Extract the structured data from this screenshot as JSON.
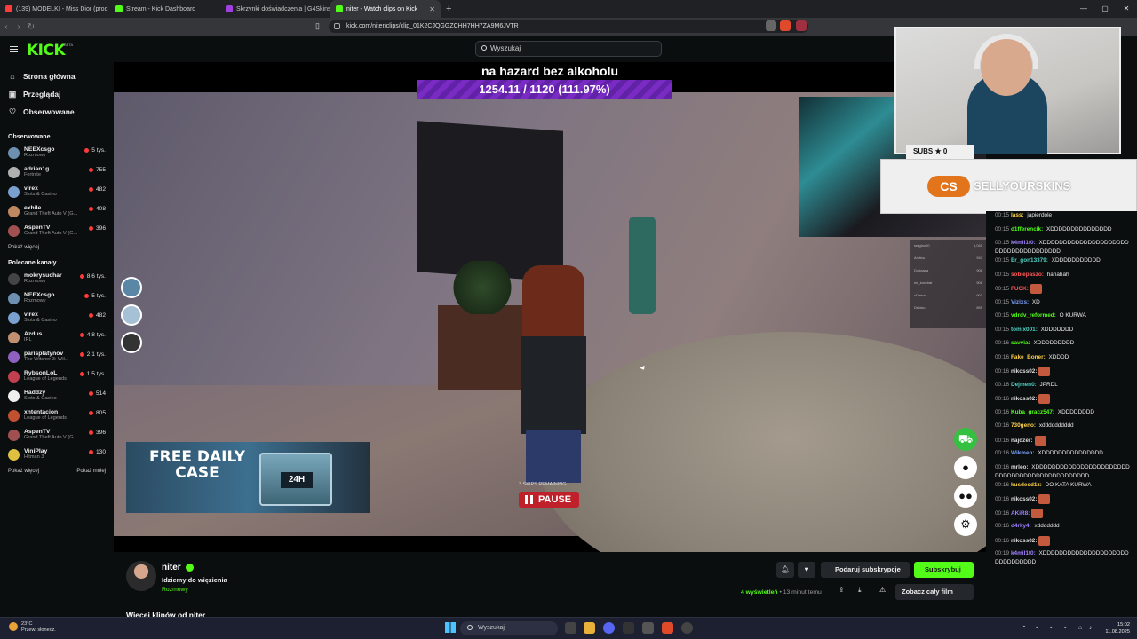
{
  "browser": {
    "tabs": [
      {
        "label": "(139) MODELKI - Miss Dior (prod",
        "color": "#ff3b3b"
      },
      {
        "label": "Stream - Kick Dashboard",
        "color": "#53fc18"
      },
      {
        "label": "Skrzynki doświadczenia | G4Skins - O",
        "color": "#a040e0"
      },
      {
        "label": "niter - Watch clips on Kick",
        "color": "#53fc18"
      }
    ],
    "new_tab": "+",
    "url": "kick.com/niter/clips/clip_01K2CJQGGZCHH7HH7ZA9M6JVTR"
  },
  "header": {
    "logo": "KICK",
    "logo_tag": "BETA",
    "search_placeholder": "Wyszukaj"
  },
  "sidebar": {
    "nav": [
      {
        "label": "Strona główna",
        "icon": "home-icon",
        "glyph": "⌂"
      },
      {
        "label": "Przeglądaj",
        "icon": "browse-icon",
        "glyph": "▣"
      },
      {
        "label": "Obserwowane",
        "icon": "heart-icon",
        "glyph": "♡"
      }
    ],
    "followed_title": "Obserwowane",
    "followed": [
      {
        "name": "NEEXcsgo",
        "category": "Rozmowy",
        "viewers": "5 tys.",
        "color": "#6d8fb0"
      },
      {
        "name": "adrian1g",
        "category": "Fortnite",
        "viewers": "755",
        "color": "#b0b0b0"
      },
      {
        "name": "virex",
        "category": "Slots & Casino",
        "viewers": "482",
        "color": "#7aa0d0"
      },
      {
        "name": "exhile",
        "category": "Grand Theft Auto V (G...",
        "viewers": "408",
        "color": "#c08860"
      },
      {
        "name": "AspenTV",
        "category": "Grand Theft Auto V (G...",
        "viewers": "396",
        "color": "#a05050"
      }
    ],
    "show_more": "Pokaż więcej",
    "recommended_title": "Polecane kanały",
    "recommended": [
      {
        "name": "mokrysuchar",
        "category": "Rozmowy",
        "viewers": "8,6 tys.",
        "color": "#444"
      },
      {
        "name": "NEEXcsgo",
        "category": "Rozmowy",
        "viewers": "5 tys.",
        "color": "#6d8fb0"
      },
      {
        "name": "virex",
        "category": "Slots & Casino",
        "viewers": "482",
        "color": "#7aa0d0"
      },
      {
        "name": "Azdus",
        "category": "IRL",
        "viewers": "4,8 tys.",
        "color": "#c09070"
      },
      {
        "name": "parisplatynov",
        "category": "The Witcher 3: Wil...",
        "viewers": "2,1 tys.",
        "color": "#9060c0"
      },
      {
        "name": "RybsonLoL",
        "category": "League of Legends",
        "viewers": "1,5 tys.",
        "color": "#c04050"
      },
      {
        "name": "Haddzy",
        "category": "Slots & Casino",
        "viewers": "514",
        "color": "#eee"
      },
      {
        "name": "xntentacion",
        "category": "League of Legends",
        "viewers": "805",
        "color": "#c05030"
      },
      {
        "name": "AspenTV",
        "category": "Grand Theft Auto V (G...",
        "viewers": "396",
        "color": "#a05050"
      },
      {
        "name": "ViniPlay",
        "category": "Hitman 3",
        "viewers": "130",
        "color": "#e0c040"
      }
    ],
    "show_more2": "Pokaż więcej",
    "show_less": "Pokaż mniej"
  },
  "video": {
    "overlay_title": "na hazard bez alkoholu",
    "goal": "1254.11 / 1120 (111.97%)",
    "daily_case": "FREE DAILY CASE",
    "case_label": "24H",
    "skips": "3 SKIPS REMAINING",
    "pause": "PAUSE",
    "subs": "SUBS ★ 0",
    "sell_logo": "CS",
    "sell_text": "SELLYOURSKINS",
    "leaderboard": [
      {
        "n": "sruglon00",
        "v": "1,041"
      },
      {
        "n": "Arcticu",
        "v": "943"
      },
      {
        "n": "Dodaaaa",
        "v": "908"
      },
      {
        "n": "mr_kondrat",
        "v": "906"
      },
      {
        "n": "xDama",
        "v": "903"
      },
      {
        "n": "Deloku",
        "v": "899"
      }
    ]
  },
  "clip": {
    "channel": "niter",
    "title": "Idziemy do więzienia",
    "category": "Rozmowy",
    "gift_label": "Podaruj subskrypcje",
    "subscribe_label": "Subskrybuj",
    "views": "4 wyświetleń",
    "time": "• 13 minut temu",
    "full_film": "Zobacz cały film",
    "more_clips": "Więcej klipów od niter"
  },
  "chat": [
    {
      "t": "00:15",
      "u": "lass:",
      "m": " japierdole",
      "c": "#ffd24a"
    },
    {
      "t": "00:15",
      "u": "d1fferencik:",
      "m": " XDDDDDDDDDDDDDDD",
      "c": "#53fc18"
    },
    {
      "t": "00:15",
      "u": "k4mil1t0:",
      "m": " XDDDDDDDDDDDDDDDDDDDDDDDDDDDDDDDDDDDDD",
      "c": "#a080ff"
    },
    {
      "t": "00:15",
      "u": "Er_gon13379:",
      "m": " XDDDDDDDDDDD",
      "c": "#4fd1c5"
    },
    {
      "t": "00:15",
      "u": "sobiepaszo:",
      "m": " hahahah",
      "c": "#ff5a5a"
    },
    {
      "t": "00:15",
      "u": "FUCK:",
      "m": "",
      "c": "#ff5a5a"
    },
    {
      "t": "00:15",
      "u": "Vizixs:",
      "m": " XD",
      "c": "#7aa0ff"
    },
    {
      "t": "00:15",
      "u": "vdrdv_reformed:",
      "m": " O KURWA",
      "c": "#53fc18"
    },
    {
      "t": "00:15",
      "u": "tomix001:",
      "m": " XDDDDDDD",
      "c": "#4fd1c5"
    },
    {
      "t": "00:16",
      "u": "savvia:",
      "m": " XDDDDDDDDD",
      "c": "#53fc18"
    },
    {
      "t": "00:16",
      "u": "Fake_Boner:",
      "m": " XDDDD",
      "c": "#ffd24a"
    },
    {
      "t": "00:16",
      "u": "nikoss02:",
      "m": "",
      "c": "#dddddd"
    },
    {
      "t": "00:16",
      "u": "Dejmen0:",
      "m": " JPRDL",
      "c": "#4fd1c5"
    },
    {
      "t": "00:16",
      "u": "nikoss02:",
      "m": "",
      "c": "#dddddd"
    },
    {
      "t": "00:16",
      "u": "Kuba_gracz547:",
      "m": " XDDDDDDDD",
      "c": "#53fc18"
    },
    {
      "t": "00:16",
      "u": "730geno:",
      "m": " xdddddddddd",
      "c": "#ffd24a"
    },
    {
      "t": "00:16",
      "u": "najdzer:",
      "m": "",
      "c": "#dddddd"
    },
    {
      "t": "00:16",
      "u": "Wikmen:",
      "m": " XDDDDDDDDDDDDDDD",
      "c": "#7aa0ff"
    },
    {
      "t": "00:16",
      "u": "mrleo:",
      "m": " XDDDDDDDDDDDDDDDDDDDDDDDDDDDDDDDDDDDDDDDDDDDDDD",
      "c": "#dddddd"
    },
    {
      "t": "00:16",
      "u": "kusdesd1z:",
      "m": " DO KATA KURWA",
      "c": "#ffd24a"
    },
    {
      "t": "00:16",
      "u": "nikoss02:",
      "m": "",
      "c": "#dddddd"
    },
    {
      "t": "00:16",
      "u": "AKiR8:",
      "m": "",
      "c": "#a080ff"
    },
    {
      "t": "00:16",
      "u": "d4rky4:",
      "m": " xddddddd",
      "c": "#a080ff"
    },
    {
      "t": "00:16",
      "u": "nikoss02:",
      "m": "",
      "c": "#dddddd"
    },
    {
      "t": "00:19",
      "u": "k4mil1t0:",
      "m": " XDDDDDDDDDDDDDDDDDDDDDDDDDDDDDDD",
      "c": "#a080ff"
    }
  ],
  "taskbar": {
    "temp": "23°C",
    "weather": "Przew. słonecz.",
    "search": "Wyszukaj",
    "time": "15:02",
    "date": "11.08.2025"
  }
}
